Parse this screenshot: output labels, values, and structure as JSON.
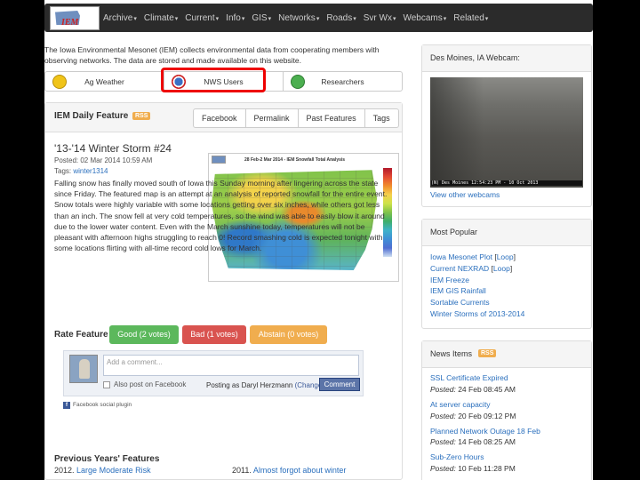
{
  "nav": {
    "logo_text": "IEM",
    "items": [
      "Archive",
      "Climate",
      "Current",
      "Info",
      "GIS",
      "Networks",
      "Roads",
      "Svr Wx",
      "Webcams",
      "Related"
    ]
  },
  "intro": "The Iowa Environmental Mesonet (IEM) collects environmental data from cooperating members with observing networks. The data are stored and made available on this website.",
  "audience_tabs": [
    "Ag Weather",
    "NWS Users",
    "Researchers"
  ],
  "feature": {
    "heading": "IEM Daily Feature",
    "rss": "RSS",
    "buttons": [
      "Facebook",
      "Permalink",
      "Past Features",
      "Tags"
    ],
    "title": "'13-'14 Winter Storm #24",
    "posted": "Posted: 02 Mar 2014 10:59 AM",
    "tags_label": "Tags:",
    "tag": "winter1314",
    "body": "Falling snow has finally moved south of Iowa this Sunday morning after lingering across the state since Friday. The featured map is an attempt at an analysis of reported snowfall for the entire event. Snow totals were highly variable with some locations getting over six inches, while others got less than an inch. The snow fell at very cold temperatures, so the wind was able to easily blow it around due to the lower water content. Even with the March sunshine today, temperatures will not be pleasant with afternoon highs struggling to reach 0! Record smashing cold is expected tonight with some locations flirting with all-time record cold lows for March.",
    "map_title": "28 Feb-2 Mar 2014 - IEM Snowfall Total Analysis",
    "rate_label": "Rate Feature",
    "good": "Good (2 votes)",
    "bad": "Bad (1 votes)",
    "abstain": "Abstain (0 votes)"
  },
  "comments": {
    "placeholder": "Add a comment...",
    "also_post": "Also post on Facebook",
    "posting_as": "Posting as Daryl Herzmann",
    "change": "(Change)",
    "button": "Comment",
    "plugin": "Facebook social plugin"
  },
  "previous": {
    "heading": "Previous Years' Features",
    "items": [
      {
        "year": "2012.",
        "title": "Large Moderate Risk"
      },
      {
        "year": "2011.",
        "title": "Almost forgot about winter"
      }
    ]
  },
  "webcam": {
    "heading": "Des Moines, IA Webcam:",
    "stamp": "(N) Des Moines 12:54:23 PM - 10 Oct 2013",
    "link": "View other webcams"
  },
  "popular": {
    "heading": "Most Popular",
    "items": [
      {
        "text": "Iowa Mesonet Plot",
        "loop": "Loop"
      },
      {
        "text": "Current NEXRAD",
        "loop": "Loop"
      },
      {
        "text": "IEM Freeze",
        "loop": ""
      },
      {
        "text": "IEM GIS Rainfall",
        "loop": ""
      },
      {
        "text": "Sortable Currents",
        "loop": ""
      },
      {
        "text": "Winter Storms of 2013-2014",
        "loop": ""
      }
    ]
  },
  "news": {
    "heading": "News Items",
    "rss": "RSS",
    "items": [
      {
        "title": "SSL Certificate Expired",
        "posted": "24 Feb 08:45 AM"
      },
      {
        "title": "At server capacity",
        "posted": "20 Feb 09:12 PM"
      },
      {
        "title": "Planned Network Outage 18 Feb",
        "posted": "14 Feb 08:25 AM"
      },
      {
        "title": "Sub-Zero Hours",
        "posted": "10 Feb 11:28 PM"
      }
    ],
    "posted_label": "Posted:"
  },
  "colors": {
    "good": "#5cb85c",
    "bad": "#d9534f",
    "abstain": "#f0ad4e",
    "link": "#2a6fbd",
    "highlight": "#ee0000"
  }
}
